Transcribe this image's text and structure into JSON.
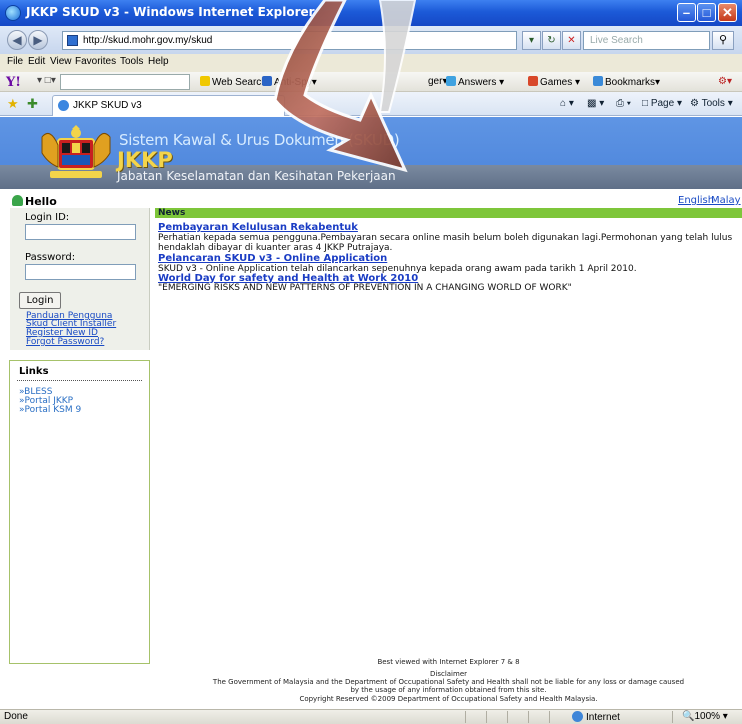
{
  "window": {
    "title": "JKKP SKUD v3 - Windows Internet Explorer",
    "min": "–",
    "max": "□",
    "close": "✕"
  },
  "address": {
    "url": "http://skud.mohr.gov.my/skud",
    "search_placeholder": "Live Search"
  },
  "menu": [
    "File",
    "Edit",
    "View",
    "Favorites",
    "Tools",
    "Help"
  ],
  "yahoo": {
    "logo": "Y!",
    "tools": [
      "Web Search",
      "Anti-Spy",
      "Answers",
      "Games",
      "Bookmarks"
    ],
    "partial_tool": "ger"
  },
  "tab": {
    "label": "JKKP SKUD v3"
  },
  "commands": [
    "Page",
    "Tools"
  ],
  "banner": {
    "system_name": "Sistem Kawal & Urus Dokumen (SKUD)",
    "org_short": "JKKP",
    "org_long": "Jabatan Keselamatan dan Kesihatan Pekerjaan"
  },
  "hello": "Hello",
  "languages": [
    "English",
    "Malay"
  ],
  "login": {
    "id_label": "Login ID:",
    "password_label": "Password:",
    "button": "Login",
    "links": [
      "Panduan Pengguna",
      "Skud Client Installer",
      "Register New ID",
      "Forgot Password?"
    ]
  },
  "links_box": {
    "title": "Links",
    "items": [
      "»BLESS",
      "»Portal JKKP",
      "»Portal KSM 9"
    ]
  },
  "news": {
    "header": "News",
    "items": [
      {
        "title": "Pembayaran Kelulusan Rekabentuk",
        "body": "Perhatian kepada semua pengguna.Pembayaran secara online masih belum boleh digunakan lagi.Permohonan yang telah lulus hendaklah dibayar di kuanter aras 4 JKKP Putrajaya."
      },
      {
        "title": "Pelancaran SKUD v3 - Online Application",
        "body": "SKUD v3 - Online Application telah dilancarkan sepenuhnya kepada orang awam pada tarikh 1 April 2010."
      },
      {
        "title": "World Day for safety and Health at Work 2010",
        "body": "\"EMERGING RISKS AND NEW PATTERNS OF PREVENTION IN A CHANGING WORLD OF WORK\""
      }
    ]
  },
  "footer": {
    "line1": "Best viewed with Internet Explorer 7 & 8",
    "line2": "Disclaimer",
    "line3": "The Government of Malaysia and the Department of Occupational Safety and Health shall not be liable for any loss or damage caused",
    "line4": "by the usage of any information obtained from this site.",
    "line5": "Copyright Reserved ©2009 Department of Occupational Safety and Health Malaysia."
  },
  "status": {
    "text": "Done",
    "zone": "Internet",
    "zoom": "100%"
  }
}
